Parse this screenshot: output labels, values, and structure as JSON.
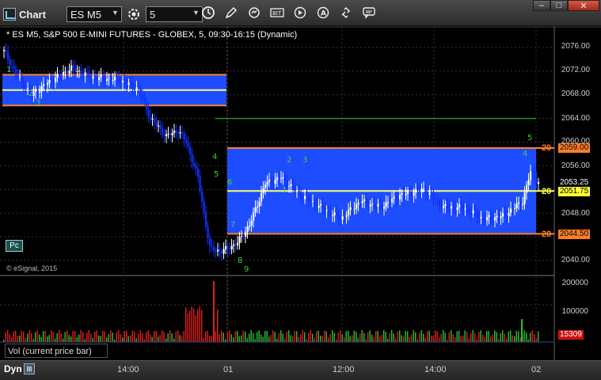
{
  "titlebar": {
    "app_title": "Chart",
    "symbol": "ES M5",
    "interval": "5",
    "buttons": {
      "minimize": "–",
      "maximize": "□",
      "close": "✕"
    }
  },
  "header": {
    "description": "* ES M5, S&P 500 E-MINI FUTURES - GLOBEX, 5, 09:30-16:15 (Dynamic)"
  },
  "chart": {
    "price_ticks": [
      "2076.00",
      "2072.00",
      "2068.00",
      "2064.00",
      "2060.00",
      "2056.00",
      "2052.00",
      "2048.00",
      "2044.00",
      "2040.00"
    ],
    "price_labels": {
      "level_high": "2059.00",
      "level_mid": "2051.75",
      "level_low": "2044.50",
      "last_price": "2053.25",
      "level_high_short": "20",
      "level_mid_short": "20",
      "level_low_short": "20"
    },
    "pc_button": "Pc",
    "copyright": "© eSignal, 2015",
    "volume_ticks": [
      "200000",
      "100000"
    ],
    "volume_last": "15309",
    "volume_label": "Vol (current price bar)",
    "x_ticks": [
      "14:00",
      "01",
      "12:00",
      "14:00",
      "02"
    ],
    "sequence_labels": [
      "1",
      "2",
      "3",
      "4",
      "5",
      "6",
      "7",
      "8",
      "9"
    ],
    "colors": {
      "zone": "#1e4dff",
      "zone_border": "#ff7f27",
      "midline": "#ffff66",
      "resistance": "#2e8b2e",
      "up_candle": "#ffffff",
      "down_candle": "#1030ff",
      "volume_up": "#30c030",
      "volume_down": "#e02020"
    }
  },
  "bottombar": {
    "mode": "Dyn"
  }
}
